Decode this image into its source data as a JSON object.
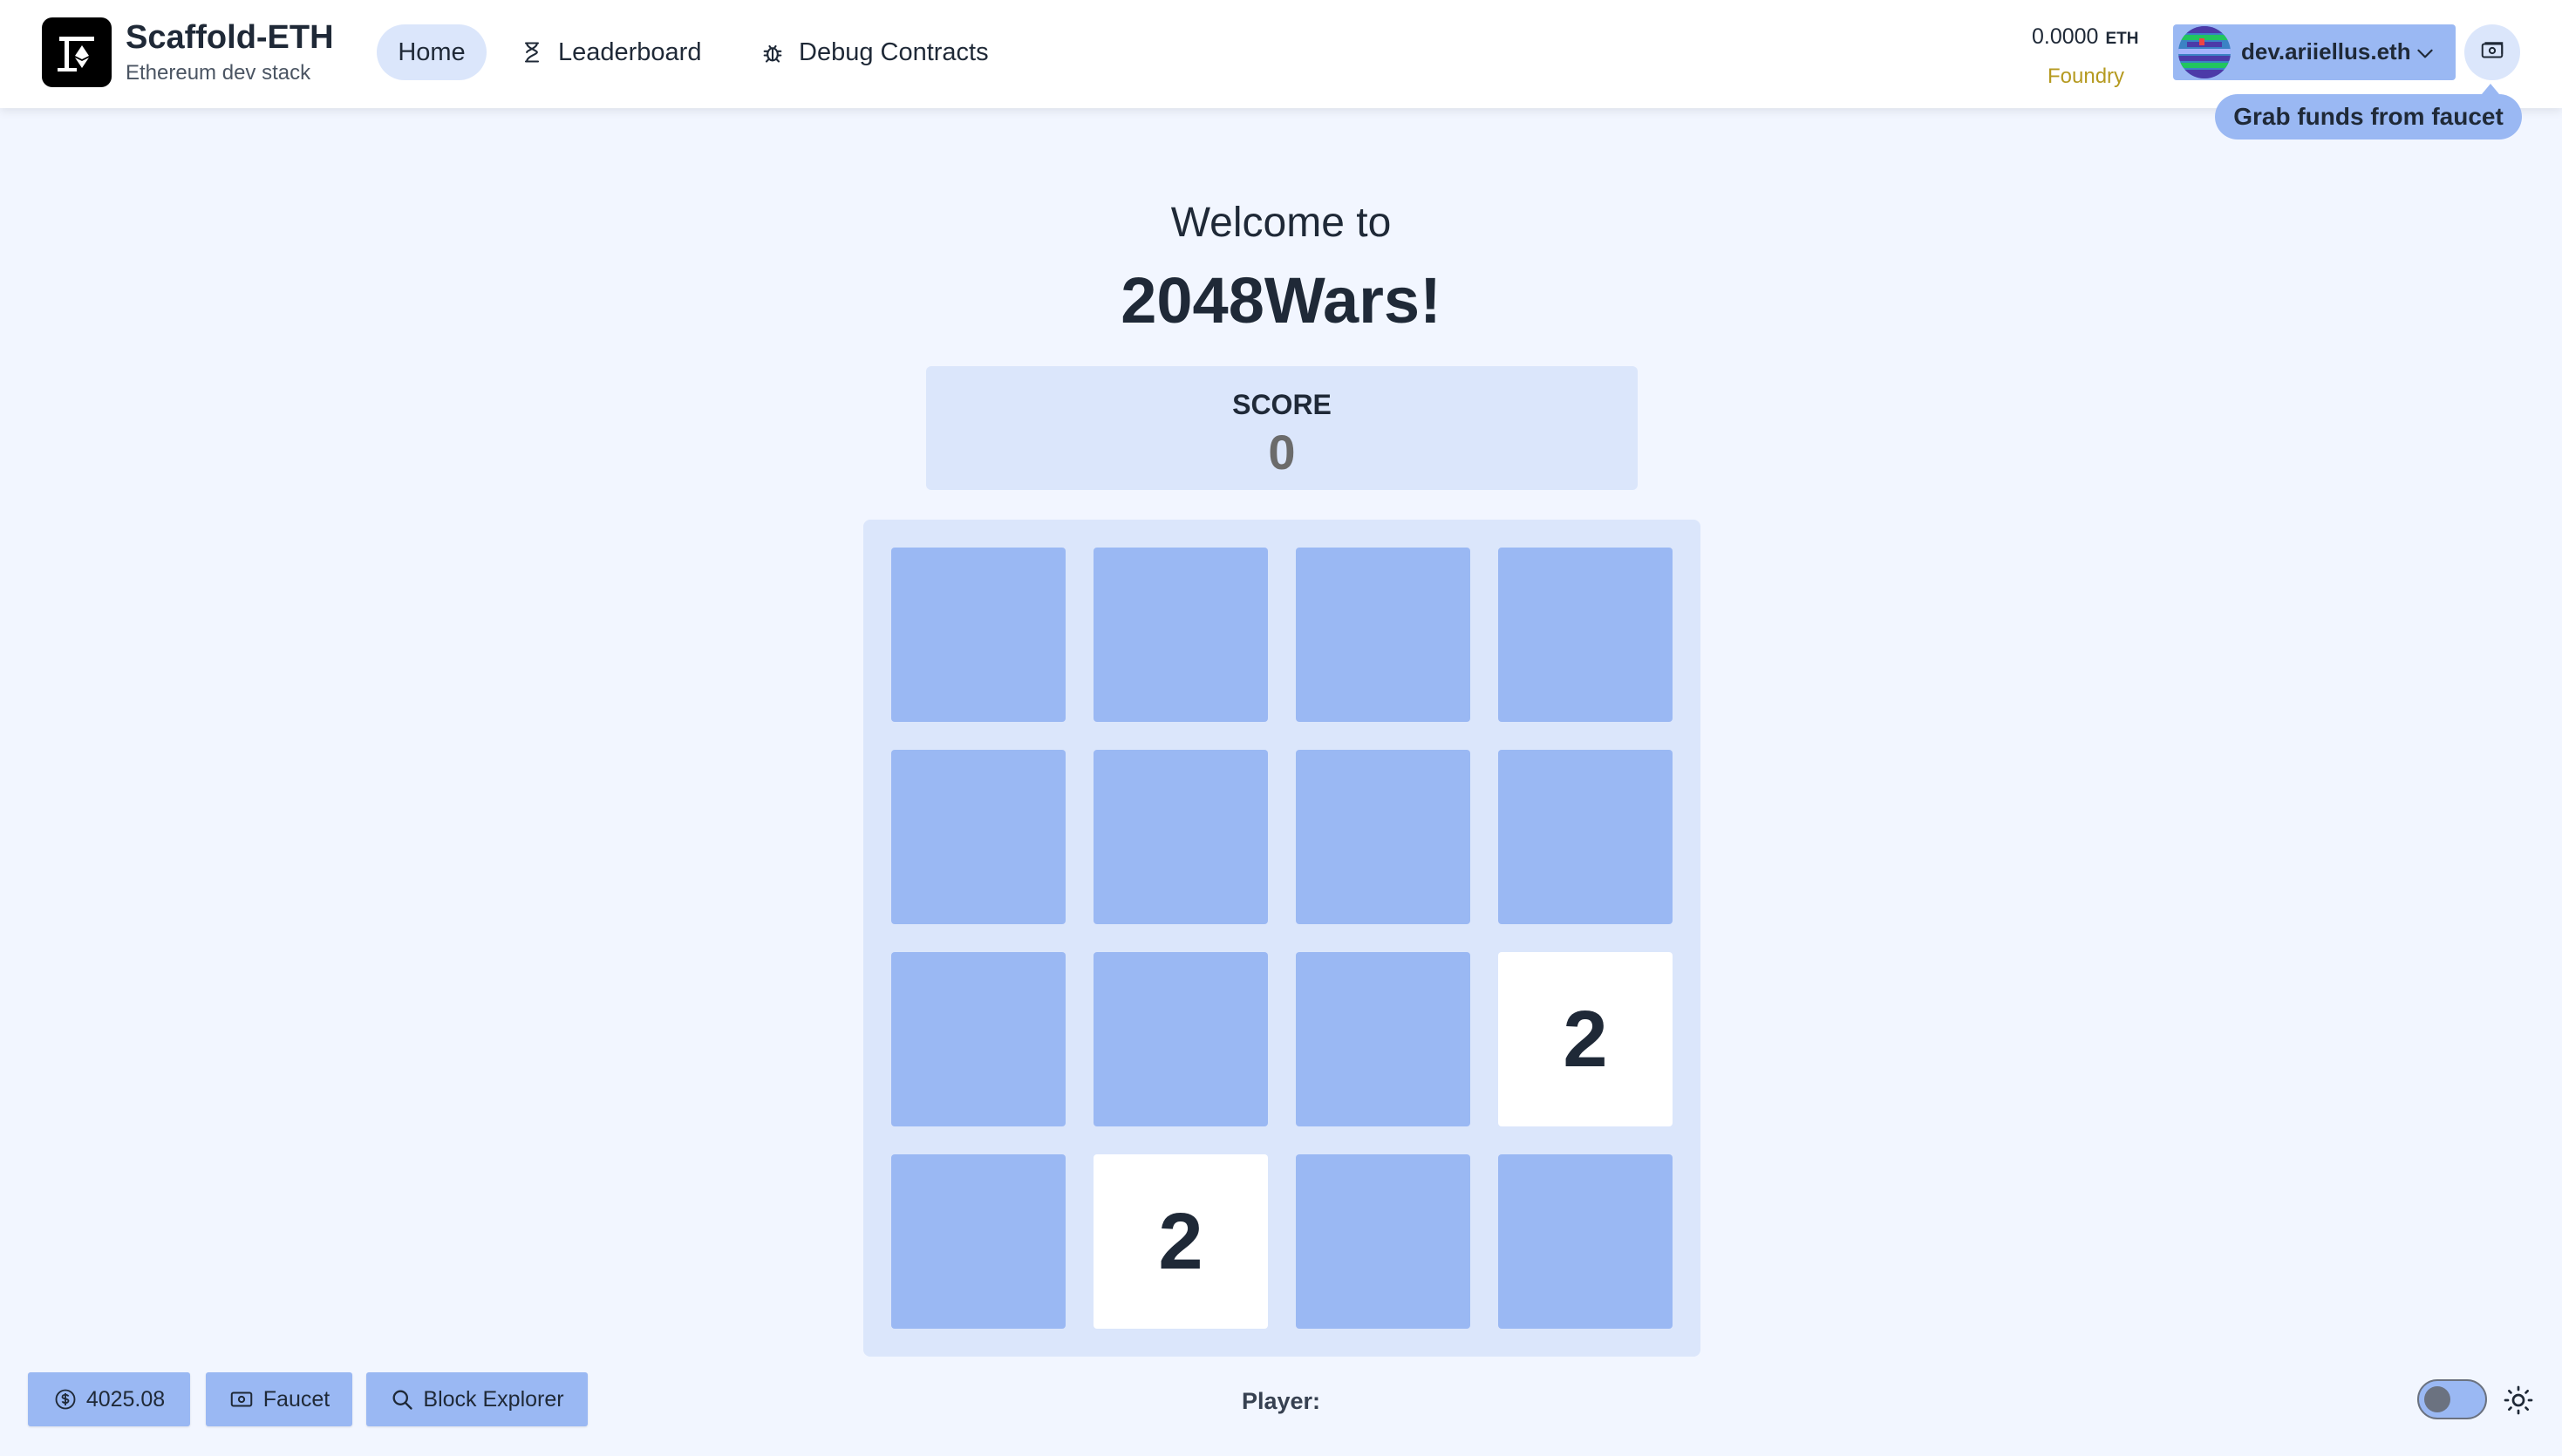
{
  "header": {
    "brand_title": "Scaffold-ETH",
    "brand_subtitle": "Ethereum dev stack",
    "nav": [
      {
        "label": "Home",
        "icon": "home"
      },
      {
        "label": "Leaderboard",
        "icon": "hourglass-icon"
      },
      {
        "label": "Debug Contracts",
        "icon": "bug-icon"
      }
    ],
    "balance_value": "0.0000",
    "balance_unit": "ETH",
    "network": "Foundry",
    "account_name": "dev.ariiellus.eth",
    "faucet_tooltip": "Grab funds from faucet"
  },
  "main": {
    "welcome": "Welcome to",
    "title": "2048Wars!",
    "score_label": "SCORE",
    "score_value": "0",
    "board": [
      [
        "",
        "",
        "",
        ""
      ],
      [
        "",
        "",
        "",
        ""
      ],
      [
        "",
        "",
        "",
        "2"
      ],
      [
        "",
        "2",
        "",
        ""
      ]
    ]
  },
  "footer": {
    "price": "4025.08",
    "faucet": "Faucet",
    "block_explorer": "Block Explorer",
    "player_label": "Player:"
  },
  "colors": {
    "background": "#f2f6ff",
    "tile_empty": "#9ab8f3",
    "tile_filled": "#ffffff",
    "board_bg": "#dbe6fb",
    "network": "#b59a20"
  }
}
